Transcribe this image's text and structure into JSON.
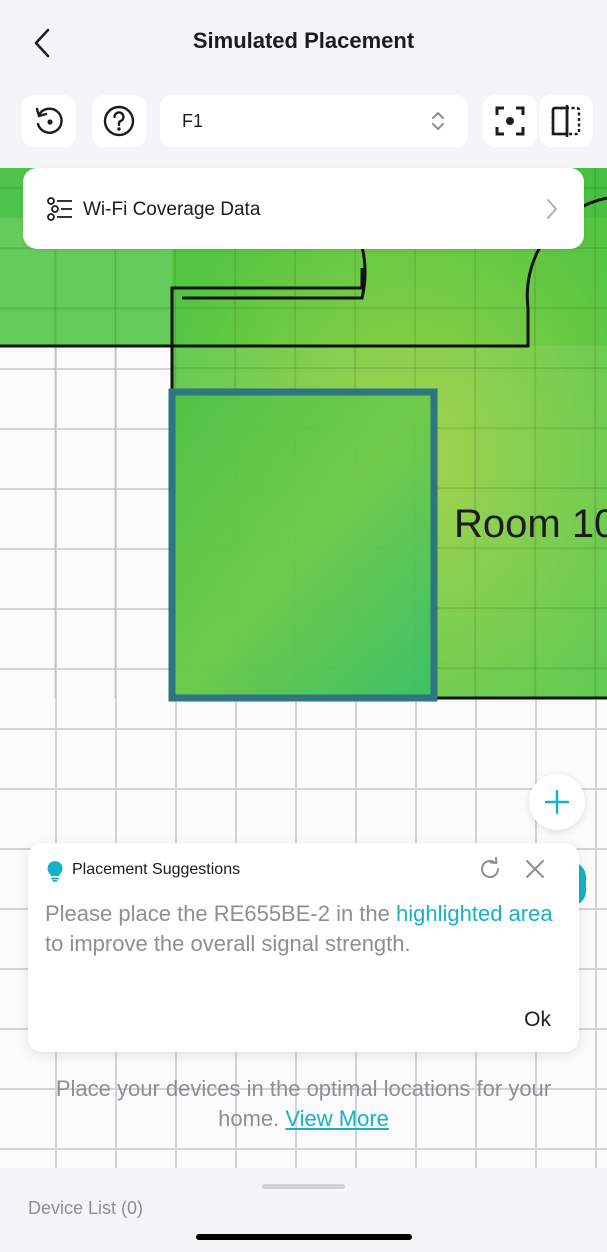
{
  "header": {
    "title": "Simulated Placement"
  },
  "toolbar": {
    "floor": "F1"
  },
  "coverage": {
    "label": "Wi-Fi Coverage Data"
  },
  "map": {
    "room_label": "Room 10"
  },
  "suggestion": {
    "title": "Placement Suggestions",
    "text_before": "Please place the RE655BE-2 in the ",
    "text_link": "highlighted area",
    "text_after": " to improve the overall signal strength.",
    "ok_label": "Ok"
  },
  "hint": {
    "text": "Place your devices in the optimal locations for your home.",
    "link": "View More"
  },
  "sheet": {
    "device_list": "Device List (0)"
  },
  "colors": {
    "accent": "#19b0c9",
    "highlight_border": "#2e7680",
    "wall": "#111111"
  }
}
